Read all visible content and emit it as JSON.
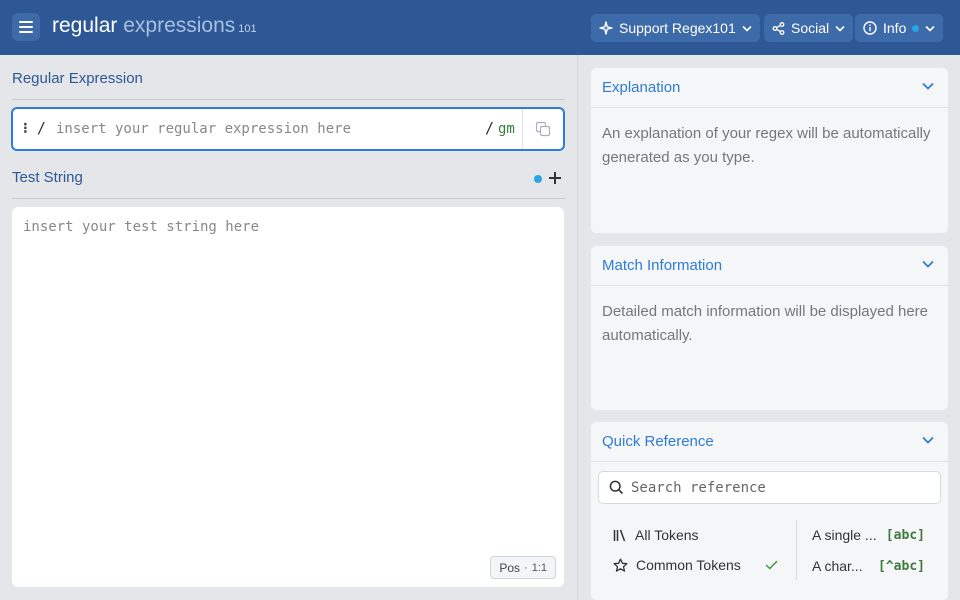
{
  "header": {
    "logo_main": "regular",
    "logo_light": "expressions",
    "logo_sub": "101",
    "support_label": "Support Regex101",
    "social_label": "Social",
    "info_label": "Info"
  },
  "regex": {
    "section_title": "Regular Expression",
    "delimiter_left": "/",
    "placeholder": "insert your regular expression here",
    "delimiter_right": "/",
    "flags": "gm"
  },
  "test": {
    "section_title": "Test String",
    "placeholder": "insert your test string here",
    "pos_label": "Pos",
    "pos_sep": "·",
    "pos_value": "1:1"
  },
  "explanation": {
    "title": "Explanation",
    "body": "An explanation of your regex will be automatically generated as you type."
  },
  "match_info": {
    "title": "Match Information",
    "body": "Detailed match information will be displayed here automatically."
  },
  "quick_ref": {
    "title": "Quick Reference",
    "search_placeholder": "Search reference",
    "categories": [
      {
        "label": "All Tokens",
        "icon": "library-icon"
      },
      {
        "label": "Common Tokens",
        "icon": "star-icon",
        "checked": true
      }
    ],
    "tokens": [
      {
        "label": "A single ...",
        "code": "[abc]"
      },
      {
        "label": "A char...",
        "code": "[^abc]"
      }
    ]
  },
  "colors": {
    "header_bg": "#2d5895",
    "accent": "#2f7bd8",
    "flag_green": "#3c7a3c",
    "dot_blue": "#29a5e8"
  }
}
